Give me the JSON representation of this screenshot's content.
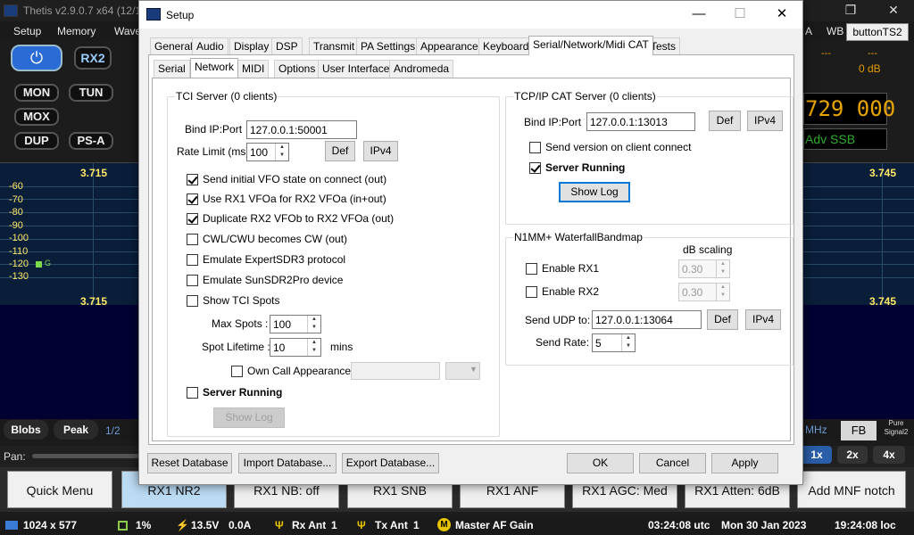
{
  "app": {
    "title": "Thetis v2.9.0.7 x64 (12/12...",
    "menu": [
      "Setup",
      "Memory",
      "Wave"
    ],
    "right_menu_a": "A",
    "right_menu_wb": "WB",
    "button_ts2": "buttonTS2",
    "db_readout": "0 dB",
    "dashes_1": "---",
    "dashes_2": "---",
    "vfo_digits": "729 000",
    "mode_text": "Adv SSB",
    "rx2_label": "RX2",
    "left_buttons": {
      "mon": "MON",
      "tun": "TUN",
      "mox": "MOX",
      "dup": "DUP",
      "psa": "PS-A"
    },
    "spectrum": {
      "freq_left": "3.715",
      "freq_right": "3.745",
      "db_labels": [
        "-60",
        "-70",
        "-80",
        "-90",
        "-100",
        "-110",
        "-120",
        "-130"
      ],
      "marker": "G"
    },
    "blobs": "Blobs",
    "peak": "Peak",
    "half": "1/2",
    "mhz": "MHz",
    "fb": "FB",
    "pure_signal": "Pure Signal2",
    "pan": "Pan:",
    "zoom": [
      "1x",
      "2x",
      "4x"
    ],
    "quick_buttons": [
      "Quick Menu",
      "RX1 NR2",
      "RX1 NB: off",
      "RX1 SNB",
      "RX1 ANF",
      "RX1 AGC: Med",
      "RX1 Atten: 6dB",
      "Add MNF notch"
    ],
    "status": {
      "resolution": "1024 x 577",
      "cpu": "1%",
      "voltage": "13.5V",
      "current": "0.0A",
      "rx_ant": "Rx Ant",
      "rx_ant_num": "1",
      "tx_ant": "Tx Ant",
      "tx_ant_num": "1",
      "master": "Master AF Gain",
      "utc": "03:24:08 utc",
      "date": "Mon 30 Jan 2023",
      "local": "19:24:08 loc"
    }
  },
  "dialog": {
    "title": "Setup",
    "tabs": [
      "General",
      "Audio",
      "Display",
      "DSP",
      "Transmit",
      "PA Settings",
      "Appearance",
      "Keyboard",
      "Serial/Network/Midi CAT",
      "Tests"
    ],
    "subtabs": [
      "Serial",
      "Network",
      "MIDI",
      "Options",
      "User Interface",
      "Andromeda"
    ],
    "tci": {
      "caption": "TCI Server (0 clients)",
      "bind_label": "Bind IP:Port",
      "bind_value": "127.0.0.1:50001",
      "rate_label": "Rate Limit (ms)",
      "rate_value": "100",
      "def": "Def",
      "ipv4": "IPv4",
      "checks": [
        "Send initial VFO state on connect (out)",
        "Use RX1 VFOa for RX2 VFOa (in+out)",
        "Duplicate RX2 VFOb to RX2 VFOa (out)",
        "CWL/CWU becomes CW (out)",
        "Emulate ExpertSDR3 protocol",
        "Emulate SunSDR2Pro device",
        "Show TCI Spots"
      ],
      "max_spots_label": "Max Spots :",
      "max_spots_value": "100",
      "spot_life_label": "Spot Lifetime :",
      "spot_life_value": "10",
      "mins": "mins",
      "own_call": "Own Call Appearance",
      "server_running": "Server Running",
      "show_log": "Show Log"
    },
    "cat": {
      "caption": "TCP/IP CAT Server (0 clients)",
      "bind_label": "Bind IP:Port",
      "bind_value": "127.0.0.1:13013",
      "def": "Def",
      "ipv4": "IPv4",
      "send_version": "Send version on client connect",
      "server_running": "Server Running",
      "show_log": "Show Log"
    },
    "n1mm": {
      "caption": "N1MM+ WaterfallBandmap",
      "db_scaling": "dB scaling",
      "enable_rx1": "Enable RX1",
      "rx1_value": "0.30",
      "enable_rx2": "Enable RX2",
      "rx2_value": "0.30",
      "send_udp_label": "Send UDP to:",
      "send_udp_value": "127.0.0.1:13064",
      "def": "Def",
      "ipv4": "IPv4",
      "send_rate_label": "Send Rate:",
      "send_rate_value": "5"
    },
    "footer": {
      "reset": "Reset Database",
      "import": "Import Database...",
      "export": "Export Database...",
      "ok": "OK",
      "cancel": "Cancel",
      "apply": "Apply"
    }
  }
}
